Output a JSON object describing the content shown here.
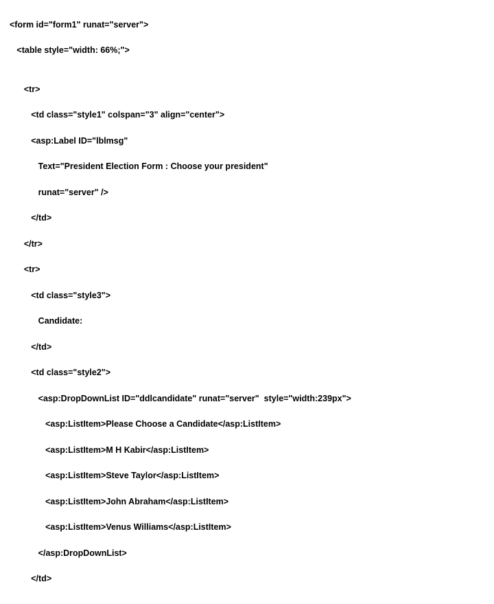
{
  "lines": [
    "<form id=\"form1\" runat=\"server\">",
    "   <table style=\"width: 66%;\">",
    "",
    "      <tr>",
    "         <td class=\"style1\" colspan=\"3\" align=\"center\">",
    "         <asp:Label ID=\"lblmsg\"",
    "            Text=\"President Election Form : Choose your president\"",
    "            runat=\"server\" />",
    "         </td>",
    "      </tr>",
    "      <tr>",
    "         <td class=\"style3\">",
    "            Candidate:",
    "         </td>",
    "         <td class=\"style2\">",
    "            <asp:DropDownList ID=\"ddlcandidate\" runat=\"server\"  style=\"width:239px\">",
    "               <asp:ListItem>Please Choose a Candidate</asp:ListItem>",
    "               <asp:ListItem>M H Kabir</asp:ListItem>",
    "               <asp:ListItem>Steve Taylor</asp:ListItem>",
    "               <asp:ListItem>John Abraham</asp:ListItem>",
    "               <asp:ListItem>Venus Williams</asp:ListItem>",
    "            </asp:DropDownList>",
    "         </td>"
  ]
}
